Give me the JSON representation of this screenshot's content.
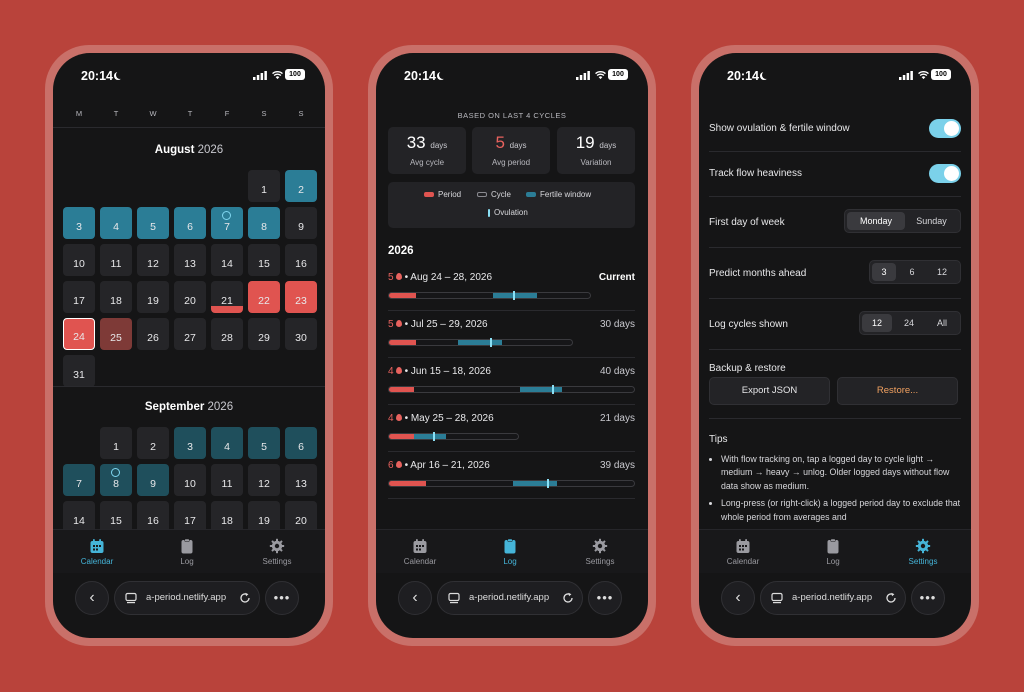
{
  "status": {
    "time": "20:14",
    "battery": "100"
  },
  "browser": {
    "url": "a-period.netlify.app"
  },
  "tabs": [
    {
      "label": "Calendar",
      "icon": "calendar-icon"
    },
    {
      "label": "Log",
      "icon": "clipboard-icon"
    },
    {
      "label": "Settings",
      "icon": "gear-icon"
    }
  ],
  "colors": {
    "accent": "#45b4d8",
    "period": "#e05450",
    "fertile": "#2b7d96",
    "ovulation": "#8be0f5",
    "background": "#b9433b"
  },
  "calendar": {
    "weekdays": [
      "M",
      "T",
      "W",
      "T",
      "F",
      "S",
      "S"
    ],
    "months": [
      {
        "name": "August",
        "year": "2026"
      },
      {
        "name": "September",
        "year": "2026"
      }
    ]
  },
  "log": {
    "based_on": "BASED ON LAST 4 CYCLES",
    "stats": [
      {
        "value": "33",
        "unit": "days",
        "label": "Avg cycle"
      },
      {
        "value": "5",
        "unit": "days",
        "label": "Avg period"
      },
      {
        "value": "19",
        "unit": "days",
        "label": "Variation"
      }
    ],
    "legend": {
      "period": "Period",
      "cycle": "Cycle",
      "fertile": "Fertile window",
      "ovulation": "Ovulation"
    },
    "year": "2026",
    "cycles": [
      {
        "period_days": "5",
        "dates": "Aug 24 – 28, 2026",
        "length": "Current",
        "period_frac": 0.11,
        "fert_start": 0.42,
        "fert_end": 0.6,
        "ov": 0.5,
        "bar_frac": 0.82
      },
      {
        "period_days": "5",
        "dates": "Jul 25 – 29, 2026",
        "length": "30 days",
        "period_frac": 0.11,
        "fert_start": 0.28,
        "fert_end": 0.46,
        "ov": 0.41,
        "bar_frac": 0.75
      },
      {
        "period_days": "4",
        "dates": "Jun 15 – 18, 2026",
        "length": "40 days",
        "period_frac": 0.1,
        "fert_start": 0.53,
        "fert_end": 0.7,
        "ov": 0.66,
        "bar_frac": 1.0
      },
      {
        "period_days": "4",
        "dates": "May 25 – 28, 2026",
        "length": "21 days",
        "period_frac": 0.1,
        "fert_start": 0.1,
        "fert_end": 0.23,
        "ov": 0.18,
        "bar_frac": 0.53
      },
      {
        "period_days": "6",
        "dates": "Apr 16 – 21, 2026",
        "length": "39 days",
        "period_frac": 0.15,
        "fert_start": 0.5,
        "fert_end": 0.68,
        "ov": 0.64,
        "bar_frac": 1.0
      }
    ]
  },
  "settings": {
    "show_ovulation": "Show ovulation & fertile window",
    "track_flow": "Track flow heaviness",
    "first_day": {
      "label": "First day of week",
      "options": [
        "Monday",
        "Sunday"
      ],
      "selected": "Monday"
    },
    "predict": {
      "label": "Predict months ahead",
      "options": [
        "3",
        "6",
        "12"
      ],
      "selected": "3"
    },
    "log_cycles": {
      "label": "Log cycles shown",
      "options": [
        "12",
        "24",
        "All"
      ],
      "selected": "12"
    },
    "backup": {
      "label": "Backup & restore",
      "export": "Export JSON",
      "restore": "Restore..."
    },
    "tips": {
      "heading": "Tips",
      "items": [
        "With flow tracking on, tap a logged day to cycle light → medium → heavy → unlog. Older logged days without flow data show as medium.",
        "Long-press (or right-click) a logged period day to exclude that whole period from averages and"
      ]
    }
  }
}
